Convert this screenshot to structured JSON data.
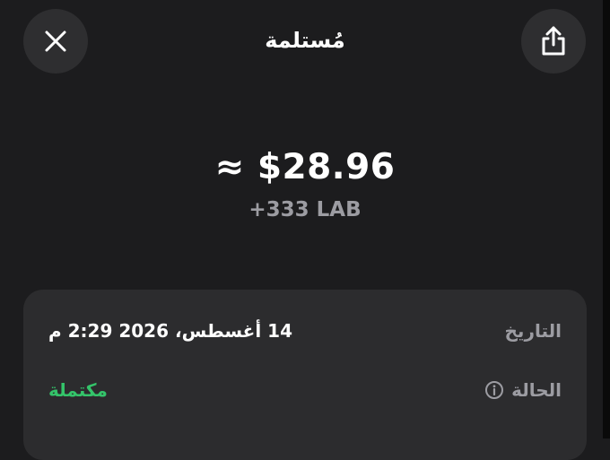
{
  "header": {
    "title": "مُستلمة",
    "close_icon": "close-icon",
    "share_icon": "share-icon"
  },
  "transaction": {
    "amount_fiat": "≈ $28.96",
    "amount_token": "+333 LAB"
  },
  "details": {
    "date_label": "التاريخ",
    "date_value": "14 أغسطس، 2026 2:29 م",
    "status_label": "الحالة",
    "status_value": "مكتملة",
    "status_info_icon": "info-icon"
  },
  "colors": {
    "background": "#1c1c1e",
    "card": "#2c2c2e",
    "button": "#2e2e30",
    "secondary_text": "#9c9ca2",
    "success": "#34c46a"
  }
}
